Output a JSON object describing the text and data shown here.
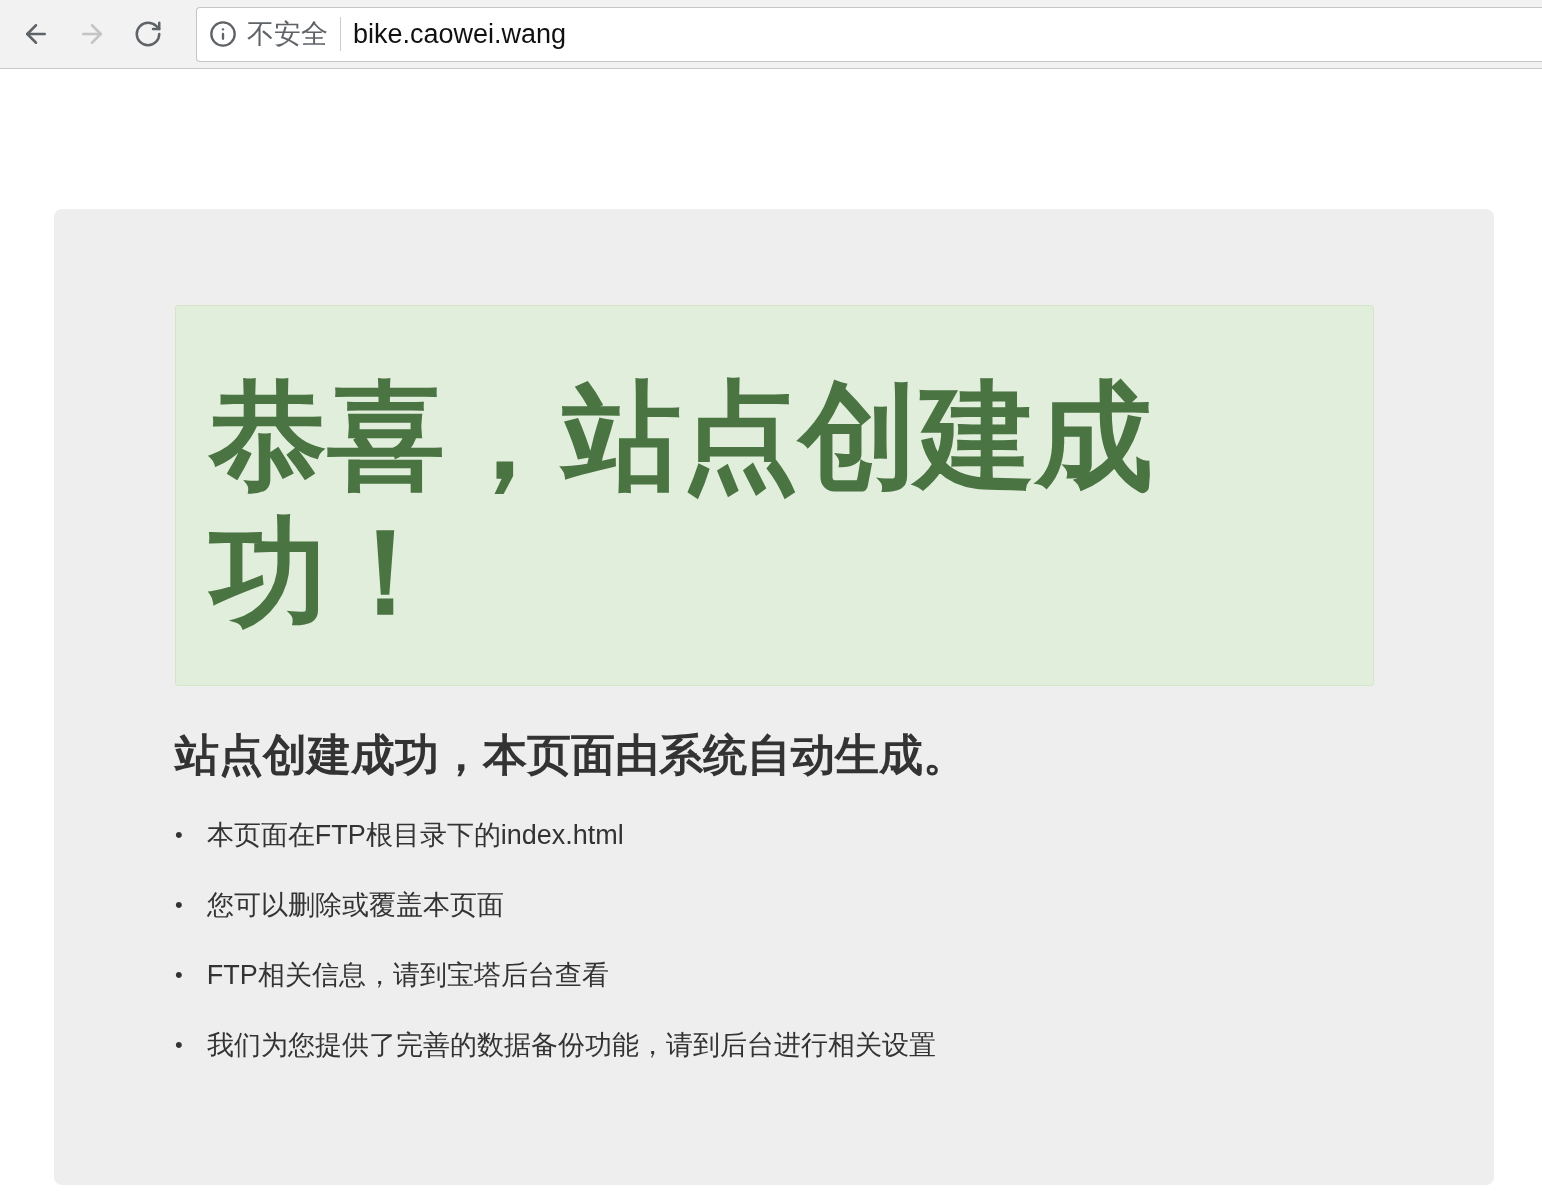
{
  "browser": {
    "nav": [
      {
        "kind": "back",
        "disabled": false
      },
      {
        "kind": "forward",
        "disabled": true
      },
      {
        "kind": "reload",
        "disabled": false
      }
    ],
    "security_label": "不安全",
    "url": "bike.caowei.wang"
  },
  "page": {
    "title": "恭喜，站点创建成功！",
    "heading": "站点创建成功，本页面由系统自动生成。",
    "items": [
      {
        "bullet": "•",
        "text": "本页面在FTP根目录下的index.html"
      },
      {
        "bullet": "•",
        "text": "您可以删除或覆盖本页面"
      },
      {
        "bullet": "•",
        "text": "FTP相关信息，请到宝塔后台查看"
      },
      {
        "bullet": "•",
        "text": "我们为您提供了完善的数据备份功能，请到后台进行相关设置"
      }
    ]
  }
}
